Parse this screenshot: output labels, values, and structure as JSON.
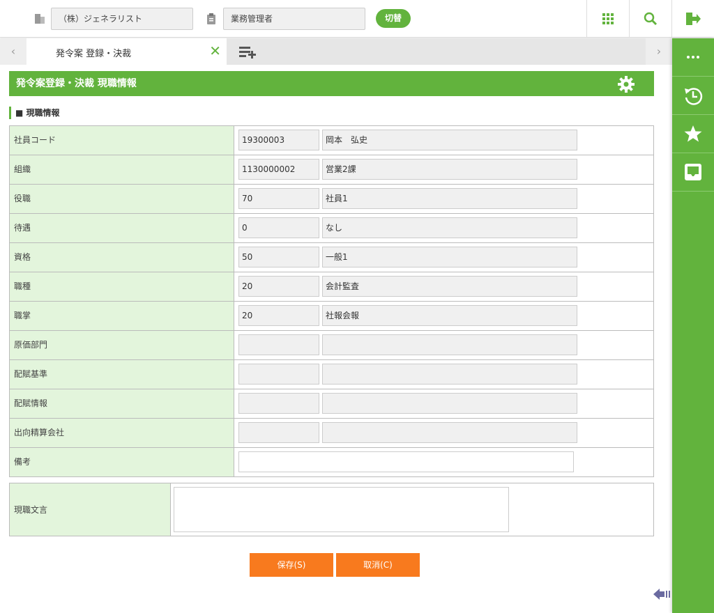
{
  "header": {
    "company": "（株）ジェネラリスト",
    "role": "業務管理者",
    "switch_label": "切替"
  },
  "tabs": {
    "active": "発令案 登録・決裁"
  },
  "title": "発令案登録・決裁 現職情報",
  "section": "■ 現職情報",
  "rows": [
    {
      "label": "社員コード",
      "code": "19300003",
      "name": "岡本　弘史"
    },
    {
      "label": "組織",
      "code": "1130000002",
      "name": "営業2課"
    },
    {
      "label": "役職",
      "code": "70",
      "name": "社員1"
    },
    {
      "label": "待遇",
      "code": "0",
      "name": "なし"
    },
    {
      "label": "資格",
      "code": "50",
      "name": "一般1"
    },
    {
      "label": "職種",
      "code": "20",
      "name": "会計監査"
    },
    {
      "label": "職掌",
      "code": "20",
      "name": "社報会報"
    },
    {
      "label": "原価部門",
      "code": "",
      "name": ""
    },
    {
      "label": "配賦基準",
      "code": "",
      "name": ""
    },
    {
      "label": "配賦情報",
      "code": "",
      "name": ""
    },
    {
      "label": "出向精算会社",
      "code": "",
      "name": ""
    }
  ],
  "remarks_label": "備考",
  "remarks_value": "",
  "text_label": "現職文言",
  "text_value": "",
  "buttons": {
    "save": "保存(S)",
    "cancel": "取消(C)"
  },
  "colors": {
    "accent": "#62b33d",
    "button": "#f87a1e",
    "label_bg": "#e3f5dc"
  }
}
